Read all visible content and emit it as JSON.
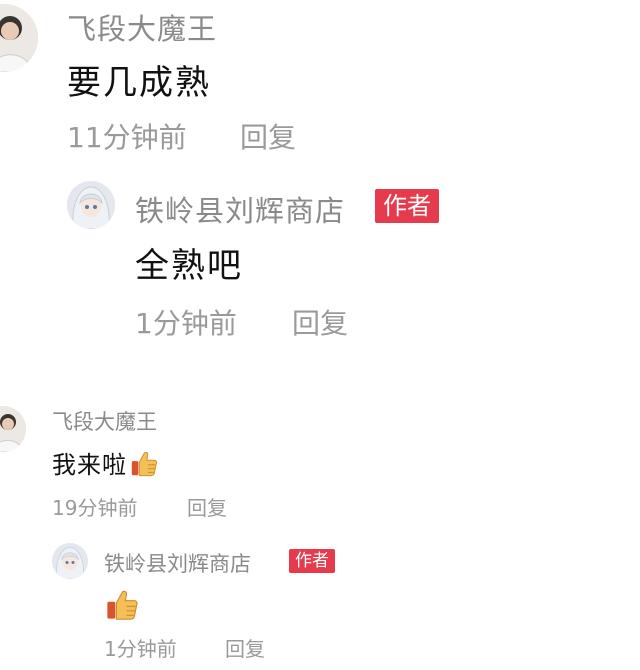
{
  "comments": [
    {
      "author": "飞段大魔王",
      "text": "要几成熟",
      "time": "11分钟前",
      "reply_label": "回复",
      "reply": {
        "author": "铁岭县刘辉商店",
        "badge": "作者",
        "text": "全熟吧",
        "time": "1分钟前",
        "reply_label": "回复"
      }
    },
    {
      "author": "飞段大魔王",
      "text": "我来啦",
      "emoji": "thumbs-up-icon",
      "time": "19分钟前",
      "reply_label": "回复",
      "reply": {
        "author": "铁岭县刘辉商店",
        "badge": "作者",
        "emoji": "thumbs-up-icon",
        "time": "1分钟前",
        "reply_label": "回复"
      }
    }
  ],
  "colors": {
    "badge_bg": "#e63a4d",
    "meta_text": "#9a9a9a",
    "name_text": "#8a8a8a",
    "body_text": "#111111"
  }
}
